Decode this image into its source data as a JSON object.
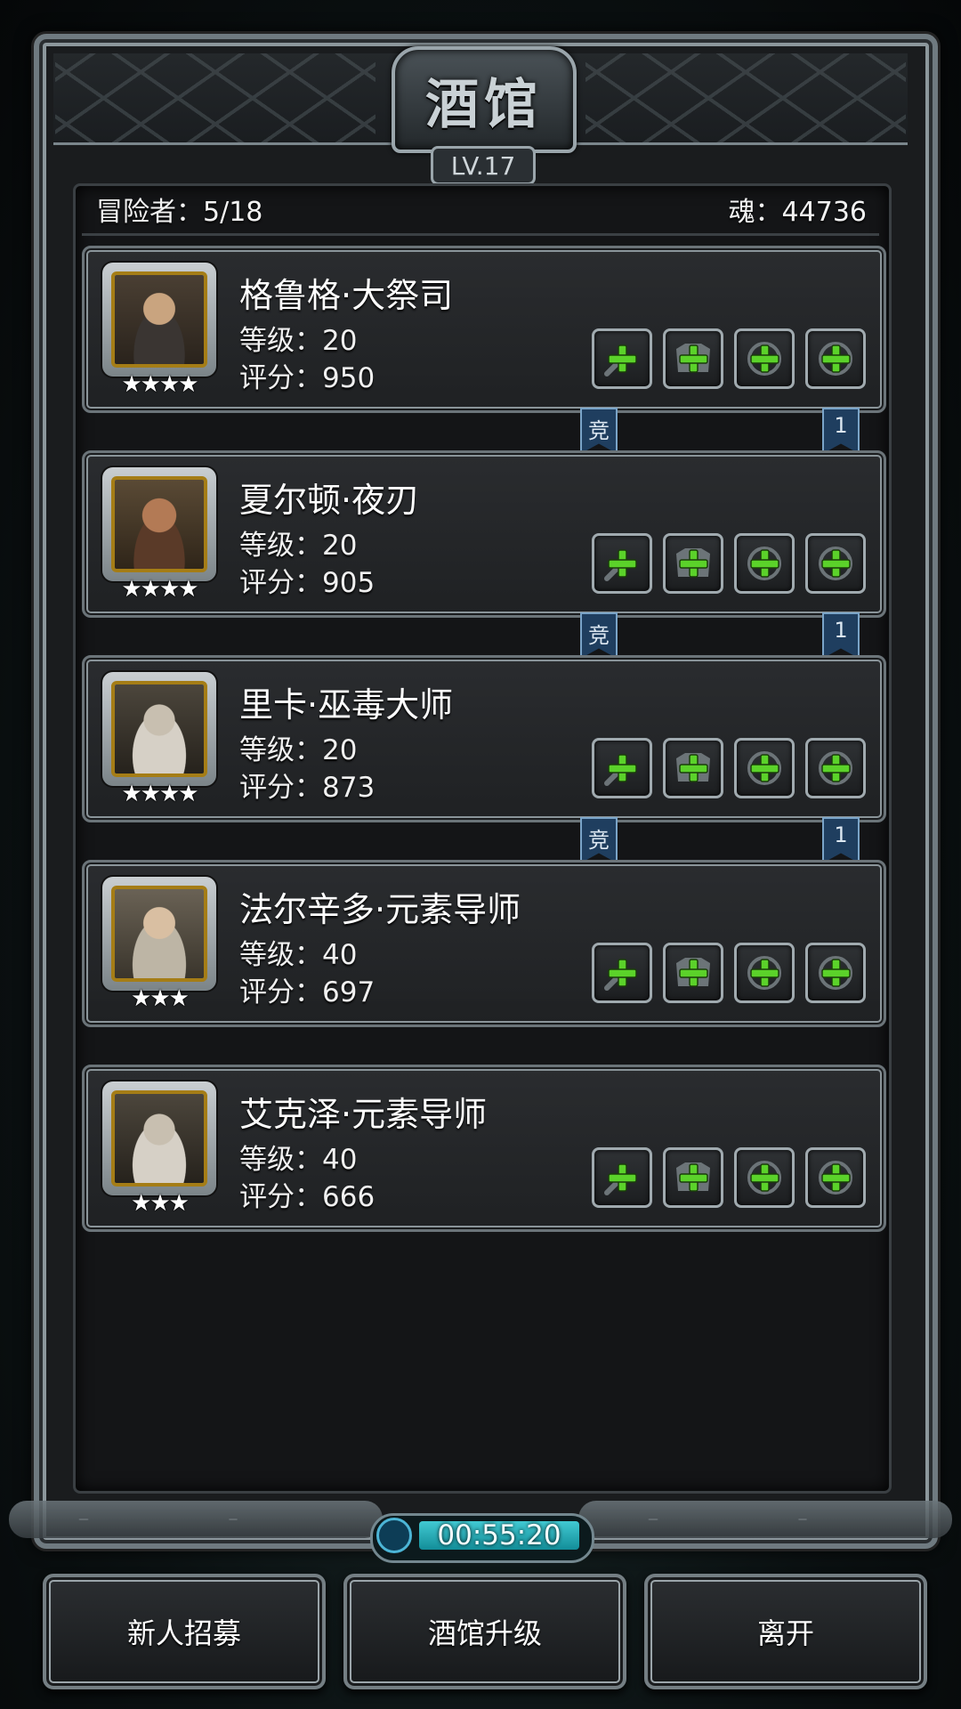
{
  "tavern": {
    "title": "酒馆",
    "level": "LV.17"
  },
  "info": {
    "adventurers": "冒险者：5/18",
    "soul": "魂：44736"
  },
  "heroes": [
    {
      "name": "格鲁格·大祭司",
      "level": "等级：20",
      "score": "评分：950",
      "stars": "★★★★",
      "tags": [
        "竞",
        "1"
      ]
    },
    {
      "name": "夏尔顿·夜刃",
      "level": "等级：20",
      "score": "评分：905",
      "stars": "★★★★",
      "tags": [
        "竞",
        "1"
      ]
    },
    {
      "name": "里卡·巫毒大师",
      "level": "等级：20",
      "score": "评分：873",
      "stars": "★★★★",
      "tags": [
        "竞",
        "1"
      ]
    },
    {
      "name": "法尔辛多·元素导师",
      "level": "等级：40",
      "score": "评分：697",
      "stars": "★★★",
      "tags": []
    },
    {
      "name": "艾克泽·元素导师",
      "level": "等级：40",
      "score": "评分：666",
      "stars": "★★★",
      "tags": []
    }
  ],
  "equipment_slot_icons": [
    "weapon-add-icon",
    "armor-add-icon",
    "ring-add-icon",
    "accessory-add-icon"
  ],
  "timer": "00:55:20",
  "buttons": {
    "recruit": "新人招募",
    "upgrade": "酒馆升级",
    "leave": "离开"
  },
  "colors": {
    "accent_green": "#5bd22a",
    "frame_silver": "#9aa5ab",
    "ribbon_blue": "#1f3e5f",
    "timer_cyan": "#2bb3be"
  }
}
